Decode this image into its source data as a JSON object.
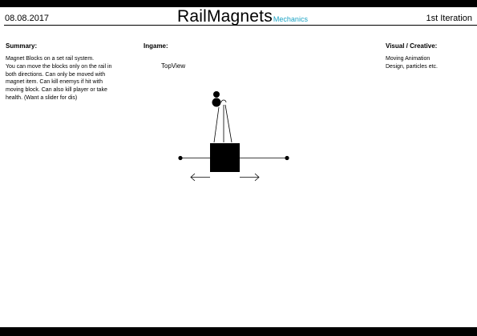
{
  "header": {
    "date": "08.08.2017",
    "title": "RailMagnets",
    "subtitle": "Mechanics",
    "iteration": "1st Iteration",
    "subtitle_color": "#1ca3c4"
  },
  "summary": {
    "heading": "Summary:",
    "lines": [
      "Magnet Blocks on a set rail system.",
      "You can move the blocks only on the rail in",
      "both directions. Can only be moved with",
      "magnet item. Can kill enemys if hit with",
      "moving block. Can also kill player or take",
      "health. (Want a slider for dis)"
    ]
  },
  "ingame": {
    "heading": "Ingame:",
    "view_label": "TopView"
  },
  "visual": {
    "heading": "Visual / Creative:",
    "lines": [
      "Moving Animation",
      "Design, particles etc."
    ]
  },
  "sketch_icons": [
    "player-figure-icon",
    "magnet-block-icon",
    "rail-icon",
    "arrow-left-icon",
    "arrow-right-icon"
  ]
}
